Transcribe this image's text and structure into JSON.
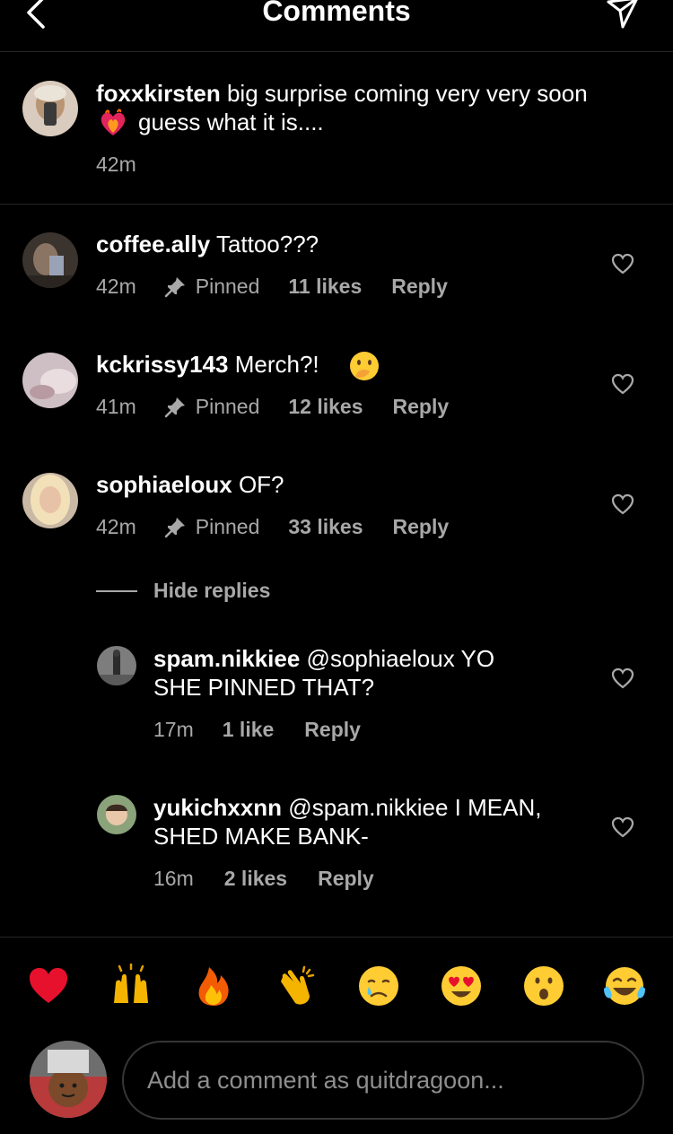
{
  "header": {
    "title": "Comments",
    "back_icon": "chevron-left-icon",
    "share_icon": "paper-plane-icon"
  },
  "caption": {
    "username": "foxxkirsten",
    "text_line1": "big surprise coming very very soon",
    "text_line2": "guess what it is....",
    "emoji": "heart-on-fire",
    "time": "42m"
  },
  "comments": [
    {
      "username": "coffee.ally",
      "text": "Tattoo???",
      "time": "42m",
      "pinned": "Pinned",
      "likes": "11 likes",
      "reply": "Reply"
    },
    {
      "username": "kckrissy143",
      "text": "Merch?!",
      "emoji": "face-with-hand-over-mouth",
      "time": "41m",
      "pinned": "Pinned",
      "likes": "12 likes",
      "reply": "Reply"
    },
    {
      "username": "sophiaeloux",
      "text": "OF?",
      "time": "42m",
      "pinned": "Pinned",
      "likes": "33 likes",
      "reply": "Reply"
    }
  ],
  "hide_replies": "Hide replies",
  "replies": [
    {
      "username": "spam.nikkiee",
      "mention": "@sophiaeloux",
      "text_line1": "YO",
      "text_line2": "SHE PINNED THAT?",
      "time": "17m",
      "likes": "1 like",
      "reply": "Reply"
    },
    {
      "username": "yukichxxnn",
      "mention": "@spam.nikkiee",
      "text_line1": "I MEAN,",
      "text_line2": "SHED MAKE BANK-",
      "time": "16m",
      "likes": "2 likes",
      "reply": "Reply"
    }
  ],
  "emoji_bar": [
    "❤️",
    "🙌",
    "🔥",
    "👏",
    "😢",
    "😍",
    "😮",
    "😂"
  ],
  "compose": {
    "placeholder": "Add a comment as quitdragoon..."
  },
  "colors": {
    "background": "#000000",
    "secondary_text": "#a8a8a8",
    "divider": "#262626"
  }
}
